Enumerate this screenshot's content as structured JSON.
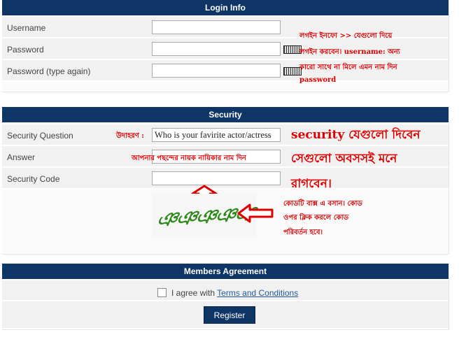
{
  "login": {
    "header": "Login Info",
    "username_label": "Username",
    "password_label": "Password",
    "password_again_label": "Password (type again)",
    "note_line1": "লগইন ইনফো >> যেগুলো দিয়ে",
    "note_line2": "লগইন করবেন। username: অন্য",
    "note_line3": "কারো সাথে না মিলে এমন নাম  দিন",
    "note_line4": "password"
  },
  "security": {
    "header": "Security",
    "question_label": "Security Question",
    "question_prefix": "উদাহরণ :",
    "question_value": "Who is your favirite actor/actress",
    "answer_label": "Answer",
    "answer_value": "আপনার পছন্দের নায়ক নায়িকার নাম দিন",
    "code_label": "Security Code",
    "big_note_line1": "security যেগুলো দিবেন",
    "big_note_line2": "সেগুলো অবসসই মনে",
    "big_note_line3": "রাগবেন।",
    "captcha_text": "ঞঞঞঞঞ",
    "captcha_note_line1": "কোডটি বাক্স এ বসান। কোড",
    "captcha_note_line2": "ওপর ক্লিক করলে কোড",
    "captcha_note_line3": "পরিবর্তন হবে।",
    "annotation_color": "#e00000"
  },
  "agreement": {
    "header": "Members Agreement",
    "agree_text": "I agree with ",
    "terms_link": "Terms and Conditions",
    "register_label": "Register"
  },
  "colors": {
    "header_bg": "#0f3566",
    "accent_link": "#1f5b9a"
  }
}
